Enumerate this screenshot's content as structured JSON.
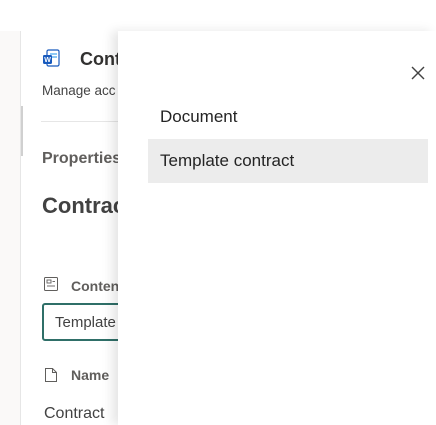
{
  "panel": {
    "title": "Cont",
    "subtitle": "Manage acc",
    "properties_label": "Properties",
    "heading": "Contrac",
    "content_type": {
      "label": "Conten",
      "value": "Template"
    },
    "name_field": {
      "label": "Name",
      "value": "Contract"
    }
  },
  "dropdown": {
    "options": [
      {
        "label": "Document",
        "selected": false
      },
      {
        "label": "Template contract",
        "selected": true
      }
    ]
  },
  "icons": {
    "app": "word-document-icon",
    "content_type": "content-type-icon",
    "name": "document-icon",
    "close": "close-icon"
  },
  "colors": {
    "accent": "#2f6f68",
    "highlight": "#ececec",
    "word_blue": "#185abd"
  }
}
